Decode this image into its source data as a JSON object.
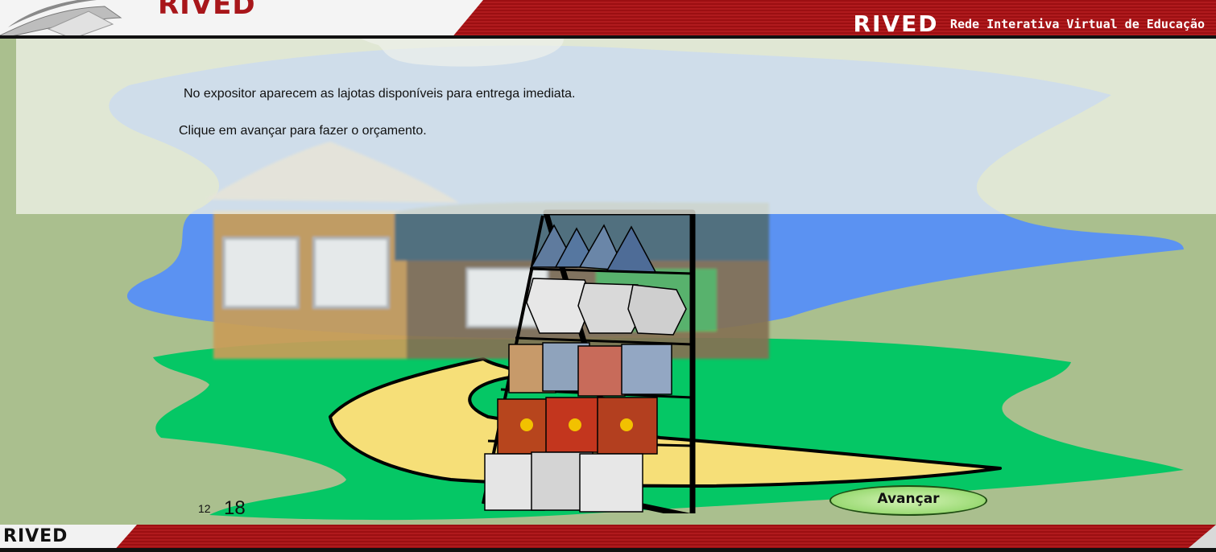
{
  "header": {
    "logo_text": "RIVED",
    "title_big": "RIVED",
    "title_small": "Rede Interativa Virtual de Educação"
  },
  "content": {
    "line1": "No expositor aparecem as lajotas disponíveis para entrega imediata.",
    "line2": "Clique em avançar para fazer o orçamento."
  },
  "footer": {
    "logo_text": "RIVED",
    "page_small": "12",
    "page_big": "18"
  },
  "actions": {
    "next_label": "Avançar"
  },
  "colors": {
    "header_red": "#9c0f12",
    "grass": "#05c765",
    "path": "#f6df78",
    "sky": "#5b92f2",
    "panel": "#f0f2e8",
    "button": "#9fdc79"
  }
}
